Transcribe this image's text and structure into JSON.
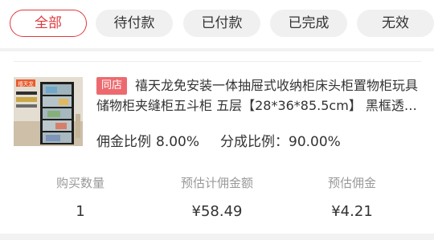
{
  "tabs": [
    "全部",
    "待付款",
    "已付款",
    "已完成",
    "无效"
  ],
  "order": {
    "store_tag": "同店",
    "title": "禧天龙免安装一体抽屉式收纳柜床头柜置物柜玩具储物柜夹缝柜五斗柜 五层【28*36*85.5cm】 黑框透明...",
    "thumb_brand": "禧天龙",
    "commission_rate_label": "佣金比例",
    "commission_rate": "8.00%",
    "share_rate_label": "分成比例：",
    "share_rate": "90.00%",
    "stats": [
      {
        "label": "购买数量",
        "value": "1"
      },
      {
        "label": "预估计佣金额",
        "value": "¥58.49"
      },
      {
        "label": "预估佣金",
        "value": "¥4.21"
      }
    ]
  },
  "colors": {
    "accent": "#e0393e",
    "tag_bg": "#ec6a6f"
  }
}
